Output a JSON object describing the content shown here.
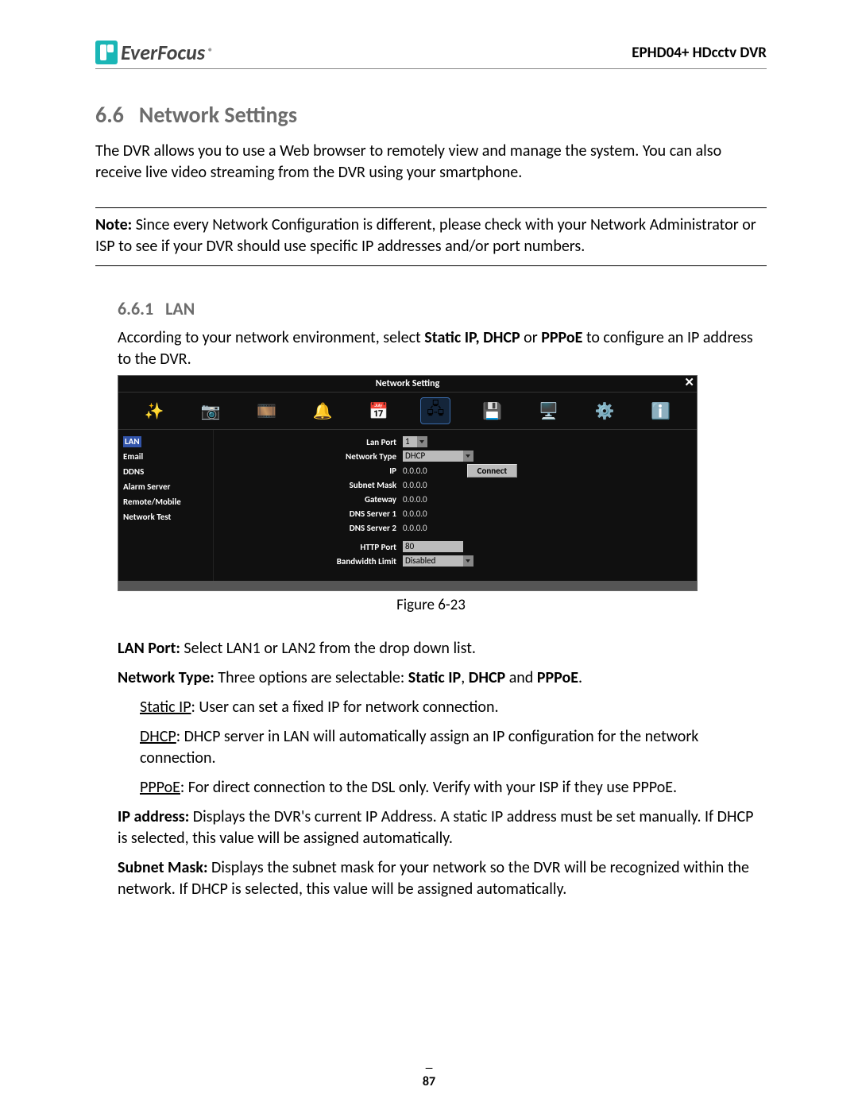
{
  "header": {
    "brand": "EverFocus",
    "reg": "®",
    "product": "EPHD04+  HDcctv DVR"
  },
  "section": {
    "num": "6.6",
    "title": "Network Settings",
    "intro": "The DVR allows you to use a Web browser to remotely view and manage the system. You can also receive live video streaming from the DVR using your smartphone."
  },
  "note": {
    "label": "Note:",
    "text": " Since every Network Configuration is different, please check with your Network Administrator or ISP to see if your DVR should use specific IP addresses and/or port numbers."
  },
  "subsection": {
    "num": "6.6.1",
    "title": "LAN",
    "intro_a": "According to your network environment, select ",
    "intro_b": "Static IP, DHCP",
    "intro_c": " or ",
    "intro_d": "PPPoE",
    "intro_e": " to configure an IP address to the DVR."
  },
  "screenshot": {
    "title": "Network Setting",
    "close": "✕",
    "sidebar": [
      "LAN",
      "Email",
      "DDNS",
      "Alarm Server",
      "Remote/Mobile",
      "Network Test"
    ],
    "toolbar_names": [
      "sparkle-wand-icon",
      "camera-icon",
      "film-reel-icon",
      "bell-icon",
      "schedule-icon",
      "network-icon",
      "hdd-icon",
      "display-icon",
      "gear-icon",
      "info-icon"
    ],
    "form": {
      "labels": {
        "lanport": "Lan Port",
        "nettype": "Network Type",
        "ip": "IP",
        "subnet": "Subnet Mask",
        "gateway": "Gateway",
        "dns1": "DNS Server 1",
        "dns2": "DNS Server 2",
        "http": "HTTP Port",
        "bw": "Bandwidth Limit"
      },
      "values": {
        "lanport": "1",
        "nettype": "DHCP",
        "ip": "0.0.0.0",
        "subnet": "0.0.0.0",
        "gateway": "0.0.0.0",
        "dns1": "0.0.0.0",
        "dns2": "0.0.0.0",
        "http": "80",
        "bw": "Disabled"
      },
      "connect": "Connect"
    }
  },
  "figcaption": "Figure 6-23",
  "definitions": {
    "lanport": {
      "label": "LAN Port:",
      "text": " Select LAN1 or LAN2 from the drop down list."
    },
    "nettype": {
      "label": "Network Type:",
      "text_a": " Three options are selectable: ",
      "opt1": "Static IP",
      "sep1": ", ",
      "opt2": "DHCP",
      "sep2": " and ",
      "opt3": "PPPoE",
      "end": "."
    },
    "static": {
      "label": "Static IP",
      "text": ": User can set a fixed IP for network connection."
    },
    "dhcp": {
      "label": "DHCP",
      "text": ": DHCP server in LAN will automatically assign an IP configuration for the network connection."
    },
    "pppoe": {
      "label": "PPPoE",
      "text": ": For direct connection to the DSL only. Verify with your ISP if they use PPPoE."
    },
    "ipaddr": {
      "label": "IP address:",
      "text": " Displays the DVR's current IP Address. A static IP address must be set manually. If DHCP is selected, this value will be assigned automatically."
    },
    "subnet": {
      "label": "Subnet Mask:",
      "text": " Displays the subnet mask for your network so the DVR will be recognized within the network. If DHCP is selected, this value will be assigned automatically."
    }
  },
  "pagenum": "87"
}
